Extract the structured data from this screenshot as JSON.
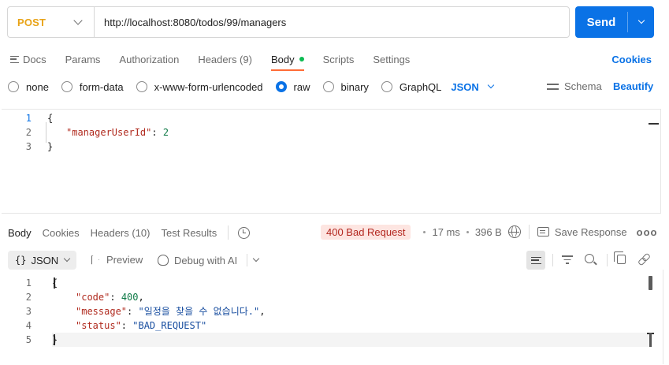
{
  "request": {
    "method": "POST",
    "url": "http://localhost:8080/todos/99/managers",
    "send_label": "Send"
  },
  "request_tabs": [
    {
      "label": "Docs"
    },
    {
      "label": "Params"
    },
    {
      "label": "Authorization"
    },
    {
      "label": "Headers (9)"
    },
    {
      "label": "Body"
    },
    {
      "label": "Scripts"
    },
    {
      "label": "Settings"
    }
  ],
  "cookies_label": "Cookies",
  "body_types": {
    "none": "none",
    "form_data": "form-data",
    "urlencoded": "x-www-form-urlencoded",
    "raw": "raw",
    "binary": "binary",
    "graphql": "GraphQL",
    "language": "JSON",
    "selected": "raw"
  },
  "schema_label": "Schema",
  "beautify_label": "Beautify",
  "request_body_lines": [
    {
      "num": "1",
      "open": "{"
    },
    {
      "num": "2",
      "key": "\"managerUserId\"",
      "sep": ": ",
      "value": "2"
    },
    {
      "num": "3",
      "close": "}"
    }
  ],
  "response_tabs": [
    {
      "label": "Body"
    },
    {
      "label": "Cookies"
    },
    {
      "label": "Headers (10)"
    },
    {
      "label": "Test Results"
    }
  ],
  "response_meta": {
    "status": "400 Bad Request",
    "time": "17 ms",
    "size": "396 B",
    "save_label": "Save Response",
    "more": "ooo"
  },
  "response_toolbar": {
    "format": "JSON",
    "braces": "{}",
    "preview": "Preview",
    "debug": "Debug with AI"
  },
  "response_body_lines": [
    {
      "num": "1",
      "text": "{"
    },
    {
      "num": "2",
      "key": "\"code\"",
      "sep": ": ",
      "value": "400",
      "trail": ","
    },
    {
      "num": "3",
      "key": "\"message\"",
      "sep": ": ",
      "value": "\"일정을 찾을 수 없습니다.\"",
      "trail": ","
    },
    {
      "num": "4",
      "key": "\"status\"",
      "sep": ": ",
      "value": "\"BAD_REQUEST\"",
      "trail": ""
    },
    {
      "num": "5",
      "text": "}"
    }
  ],
  "colors": {
    "accent": "#0a72e6",
    "method_post": "#e8a317",
    "active_tab_underline": "#ff6c37",
    "status_error_bg": "#fde5e1",
    "status_error_text": "#b3261e",
    "json_key": "#b02a1e",
    "json_number": "#0f7a47",
    "json_string": "#1a4fa0"
  }
}
